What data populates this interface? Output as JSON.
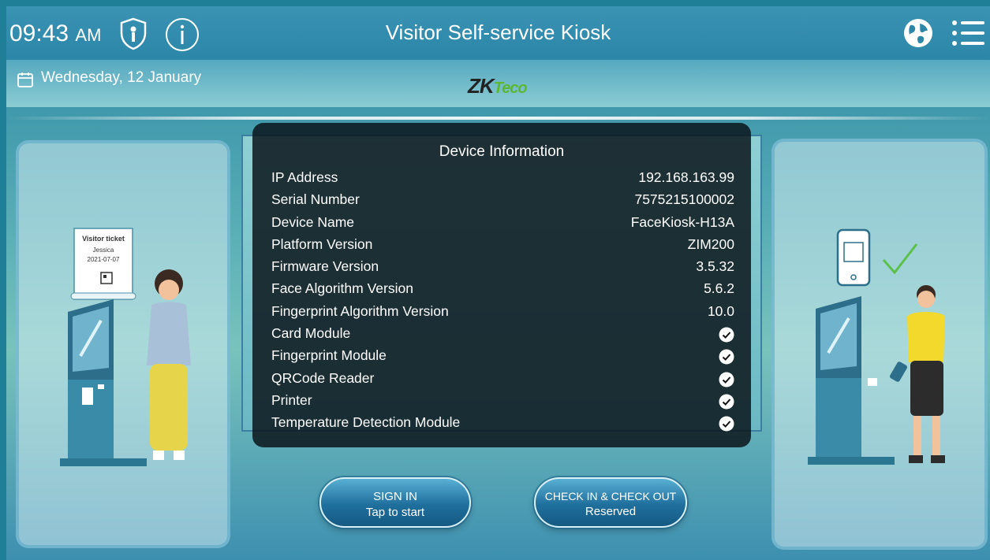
{
  "header": {
    "time": "09:43",
    "ampm": "AM",
    "title": "Visitor Self-service Kiosk",
    "date": "Wednesday, 12 January",
    "logo_main": "ZK",
    "logo_sub": "Teco"
  },
  "left_panel": {
    "ticket_title": "Visitor ticket",
    "ticket_name": "Jessica",
    "ticket_date": "2021-07-07"
  },
  "dialog": {
    "title": "Device Information",
    "rows": [
      {
        "label": "IP Address",
        "value": "192.168.163.99"
      },
      {
        "label": "Serial Number",
        "value": "7575215100002"
      },
      {
        "label": "Device Name",
        "value": "FaceKiosk-H13A"
      },
      {
        "label": "Platform Version",
        "value": "ZIM200"
      },
      {
        "label": "Firmware Version",
        "value": "3.5.32"
      },
      {
        "label": "Face Algorithm Version",
        "value": "5.6.2"
      },
      {
        "label": "Fingerprint Algorithm Version",
        "value": "10.0"
      },
      {
        "label": "Card Module",
        "status": "check-icon"
      },
      {
        "label": "Fingerprint Module",
        "status": "check-icon"
      },
      {
        "label": "QRCode Reader",
        "status": "check-icon"
      },
      {
        "label": "Printer",
        "status": "check-icon"
      },
      {
        "label": "Temperature Detection Module",
        "status": "check-icon"
      }
    ]
  },
  "buttons": {
    "signin_label": "SIGN IN",
    "signin_sub": "Tap to start",
    "checkinout_label": "CHECK IN & CHECK OUT",
    "checkinout_sub": "Reserved"
  },
  "colors": {
    "accent": "#1f6f9d",
    "brand_green": "#5cb82e",
    "dialog_bg": "#0c161c"
  }
}
